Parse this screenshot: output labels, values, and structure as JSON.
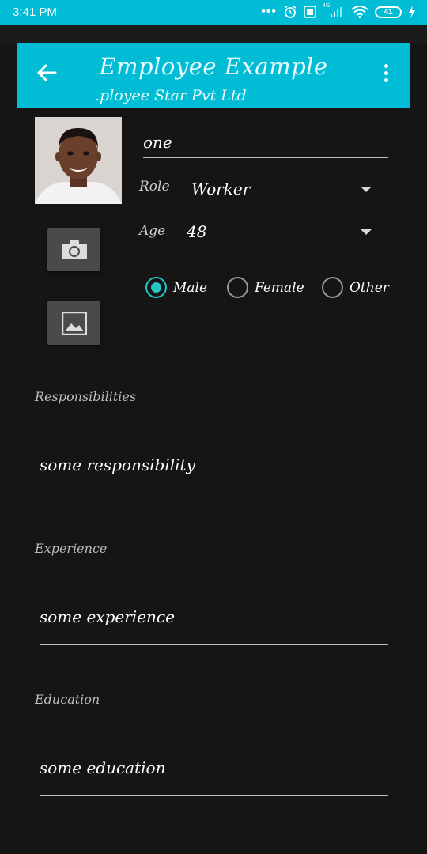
{
  "status_bar": {
    "time": "3:41 PM",
    "overflow": "•••",
    "network_label": "4G",
    "battery": "41",
    "icons": [
      "alarm-icon",
      "volte-icon",
      "signal-icon",
      "wifi-icon",
      "battery-icon",
      "charging-icon"
    ]
  },
  "toolbar": {
    "title": "Employee Example",
    "subtitle": "ployee Star Pvt Ltd.",
    "background": "#00bcd4"
  },
  "profile": {
    "name": "one",
    "role_label": "Role",
    "role_value": "Worker",
    "age_label": "Age",
    "age_value": "48"
  },
  "gender": {
    "options": [
      "Male",
      "Female",
      "Other"
    ],
    "selected": "Male"
  },
  "sections": {
    "responsibilities_label": "Responsibilities",
    "responsibilities_value": "some responsibility",
    "experience_label": "Experience",
    "experience_value": "some experience",
    "education_label": "Education",
    "education_value": "some education"
  },
  "colors": {
    "accent": "#00bcd4",
    "radio_checked": "#26c6c6",
    "background": "#151515"
  }
}
